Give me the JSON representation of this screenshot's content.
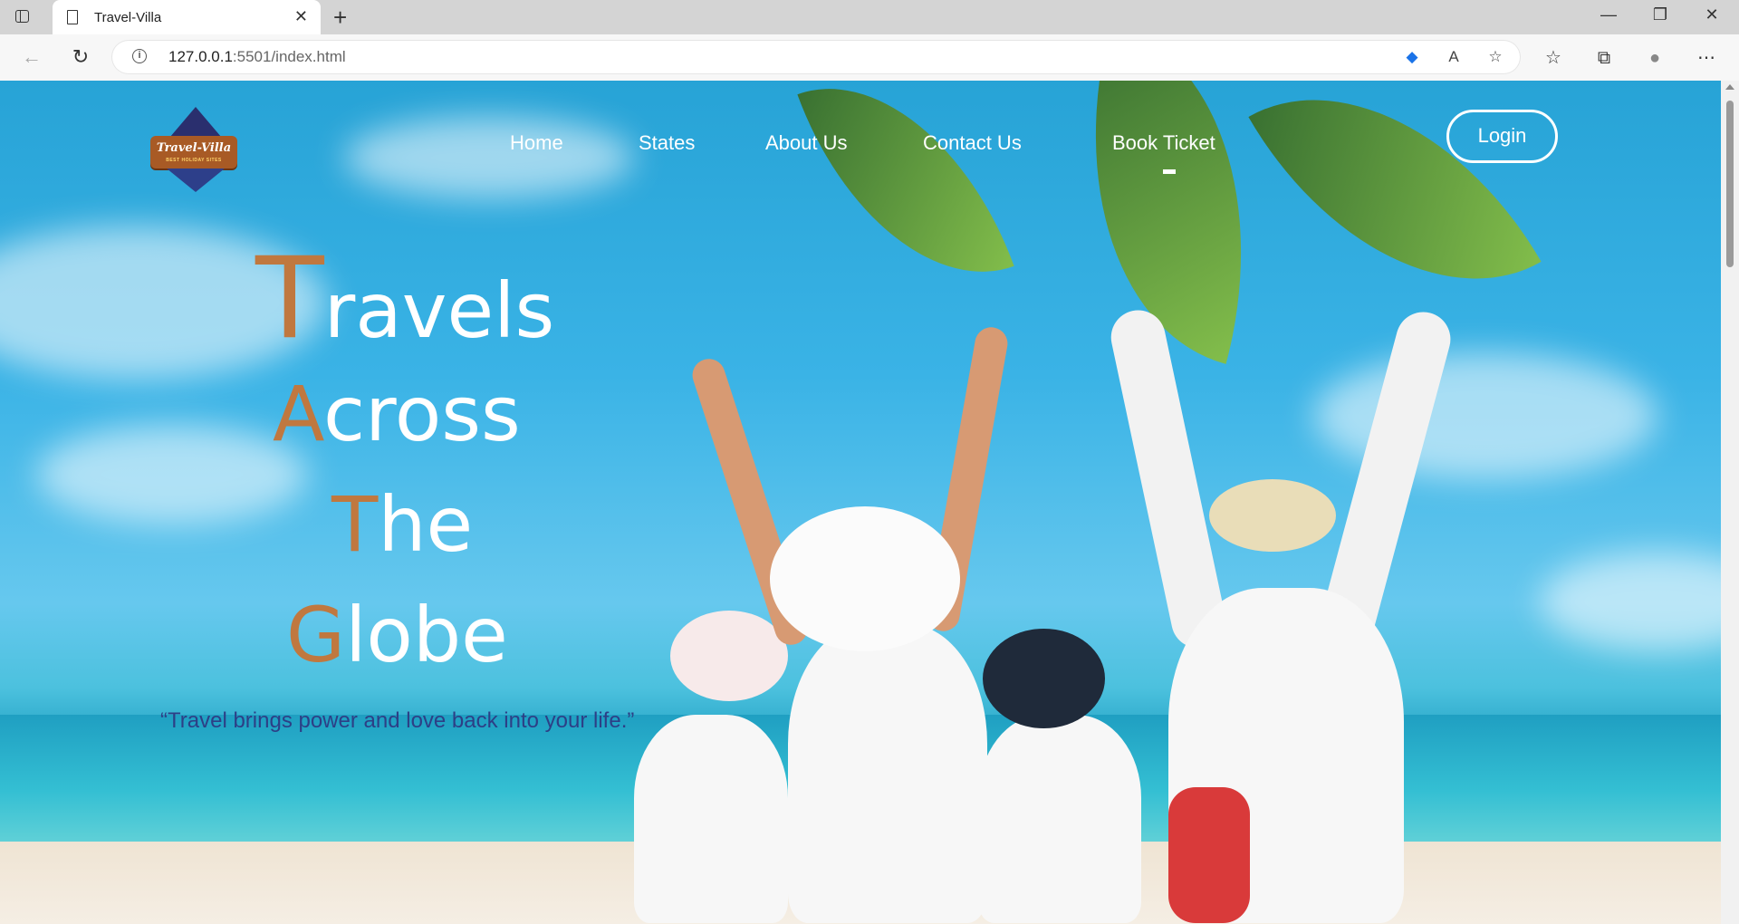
{
  "browser": {
    "tab_title": "Travel-Villa",
    "tab_close": "✕",
    "new_tab": "+",
    "url_host": "127.0.0.1",
    "url_rest": ":5501/index.html",
    "window_controls": {
      "minimize": "—",
      "restore": "❐",
      "close": "✕"
    },
    "info_icon_glyph": "i"
  },
  "site": {
    "logo_text": "Travel-Villa",
    "logo_subtext": "BEST HOLIDAY SITES",
    "nav": [
      "Home",
      "States",
      "About Us",
      "Contact Us",
      "Book Ticket"
    ],
    "active_nav": "Book Ticket",
    "login_label": "Login",
    "hero": [
      {
        "cap": "T",
        "rest": "ravels"
      },
      {
        "cap": "A",
        "rest": "cross"
      },
      {
        "cap": "T",
        "rest": "he"
      },
      {
        "cap": "G",
        "rest": "lobe"
      }
    ],
    "quote": "“Travel brings power and love back into your life.”"
  },
  "colors": {
    "accent_letter": "#c0783f",
    "quote_text": "#2d3f86",
    "sky": "#3ab3e6"
  }
}
